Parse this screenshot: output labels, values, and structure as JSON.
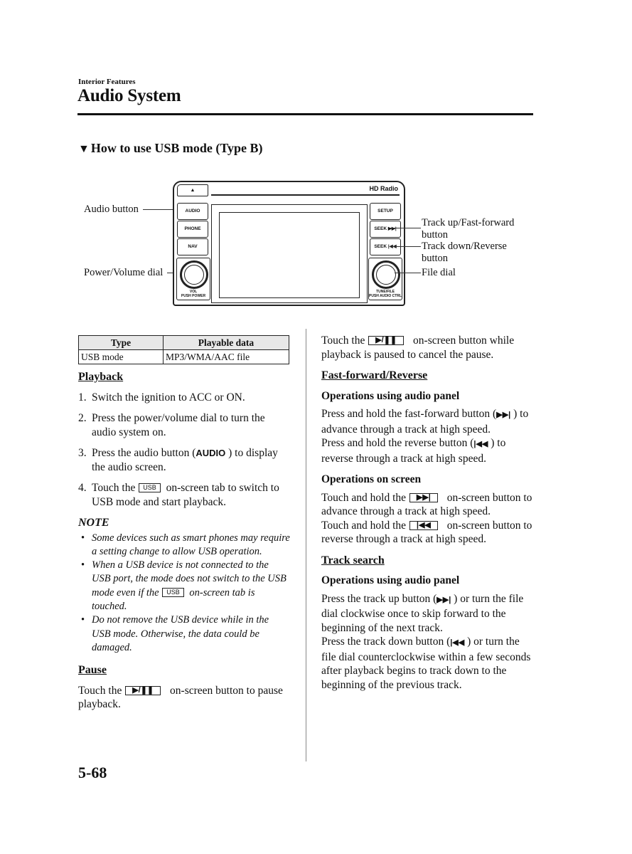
{
  "header": {
    "section": "Interior Features",
    "title": "Audio System"
  },
  "subheading": {
    "marker_icon": "down-triangle-icon",
    "marker": "▼",
    "text": "How to use USB mode (Type B)"
  },
  "diagram": {
    "callouts_left": [
      "Audio button",
      "Power/Volume dial"
    ],
    "callouts_right": {
      "track_up": [
        "Track up/Fast-forward",
        "button"
      ],
      "track_down": [
        "Track down/Reverse",
        "button"
      ],
      "file_dial": "File dial"
    },
    "panel": {
      "eject": "▲",
      "brand": "HD Radio",
      "left_buttons": [
        "AUDIO",
        "PHONE",
        "NAV"
      ],
      "right_buttons": [
        "SETUP",
        "SEEK ▶▶|",
        "SEEK |◀◀"
      ],
      "left_knob_label": [
        "VOL",
        "PUSH POWER"
      ],
      "right_knob_label": [
        "TUNE/FILE",
        "PUSH AUDIO CTRL"
      ]
    }
  },
  "table": {
    "headers": [
      "Type",
      "Playable data"
    ],
    "rows": [
      [
        "USB mode",
        "MP3/WMA/AAC file"
      ]
    ]
  },
  "playback": {
    "heading": "Playback",
    "steps": [
      {
        "num": "1.",
        "text": "Switch the ignition to ACC or ON."
      },
      {
        "num": "2.",
        "text": "Press the power/volume dial to turn the audio system on."
      },
      {
        "num": "3.",
        "pre": "Press the audio button (",
        "glyph": "AUDIO",
        "post": " ) to display the audio screen."
      },
      {
        "num": "4.",
        "pre": "Touch the ",
        "glyph": "USB",
        "post": " on-screen tab to switch to USB mode and start playback."
      }
    ]
  },
  "note": {
    "title": "NOTE",
    "bullet": "•",
    "items": [
      {
        "text": "Some devices such as smart phones may require a setting change to allow USB operation."
      },
      {
        "pre": "When a USB device is not connected to the USB port, the mode does not switch to the USB mode even if the ",
        "glyph": "USB",
        "post": " on-screen tab is touched."
      },
      {
        "text": "Do not remove the USB device while in the USB mode. Otherwise, the data could be damaged."
      }
    ]
  },
  "pause": {
    "heading": "Pause",
    "pre": "Touch the ",
    "glyph": "▶/❚❚",
    "post": " on-screen button to pause playback."
  },
  "resume": {
    "pre": "Touch the ",
    "glyph": "▶/❚❚",
    "post": " on-screen button while playback is paused to cancel the pause."
  },
  "fast_forward": {
    "heading": "Fast-forward/Reverse",
    "panel_heading": "Operations using audio panel",
    "panel_ff": {
      "pre": "Press and hold the fast-forward button (",
      "glyph": "▶▶|",
      "post": " ) to advance through a track at high speed."
    },
    "panel_rev": {
      "pre": "Press and hold the reverse button (",
      "glyph": "|◀◀",
      "post": " ) to reverse through a track at high speed."
    },
    "screen_heading": "Operations on screen",
    "screen_ff": {
      "pre": "Touch and hold the ",
      "glyph": "▶▶|",
      "post": " on-screen button to advance through a track at high speed."
    },
    "screen_rev": {
      "pre": "Touch and hold the ",
      "glyph": "|◀◀",
      "post": " on-screen button to reverse through a track at high speed."
    }
  },
  "track_search": {
    "heading": "Track search",
    "panel_heading": "Operations using audio panel",
    "up": {
      "pre": "Press the track up button (",
      "glyph": "▶▶|",
      "post": " ) or turn the file dial clockwise once to skip forward to the beginning of the next track."
    },
    "down": {
      "pre": "Press the track down button (",
      "glyph": "|◀◀",
      "post": " ) or turn the file dial counterclockwise within a few seconds after playback begins to track down to the beginning of the previous track."
    }
  },
  "footer": {
    "page_number": "5-68"
  }
}
